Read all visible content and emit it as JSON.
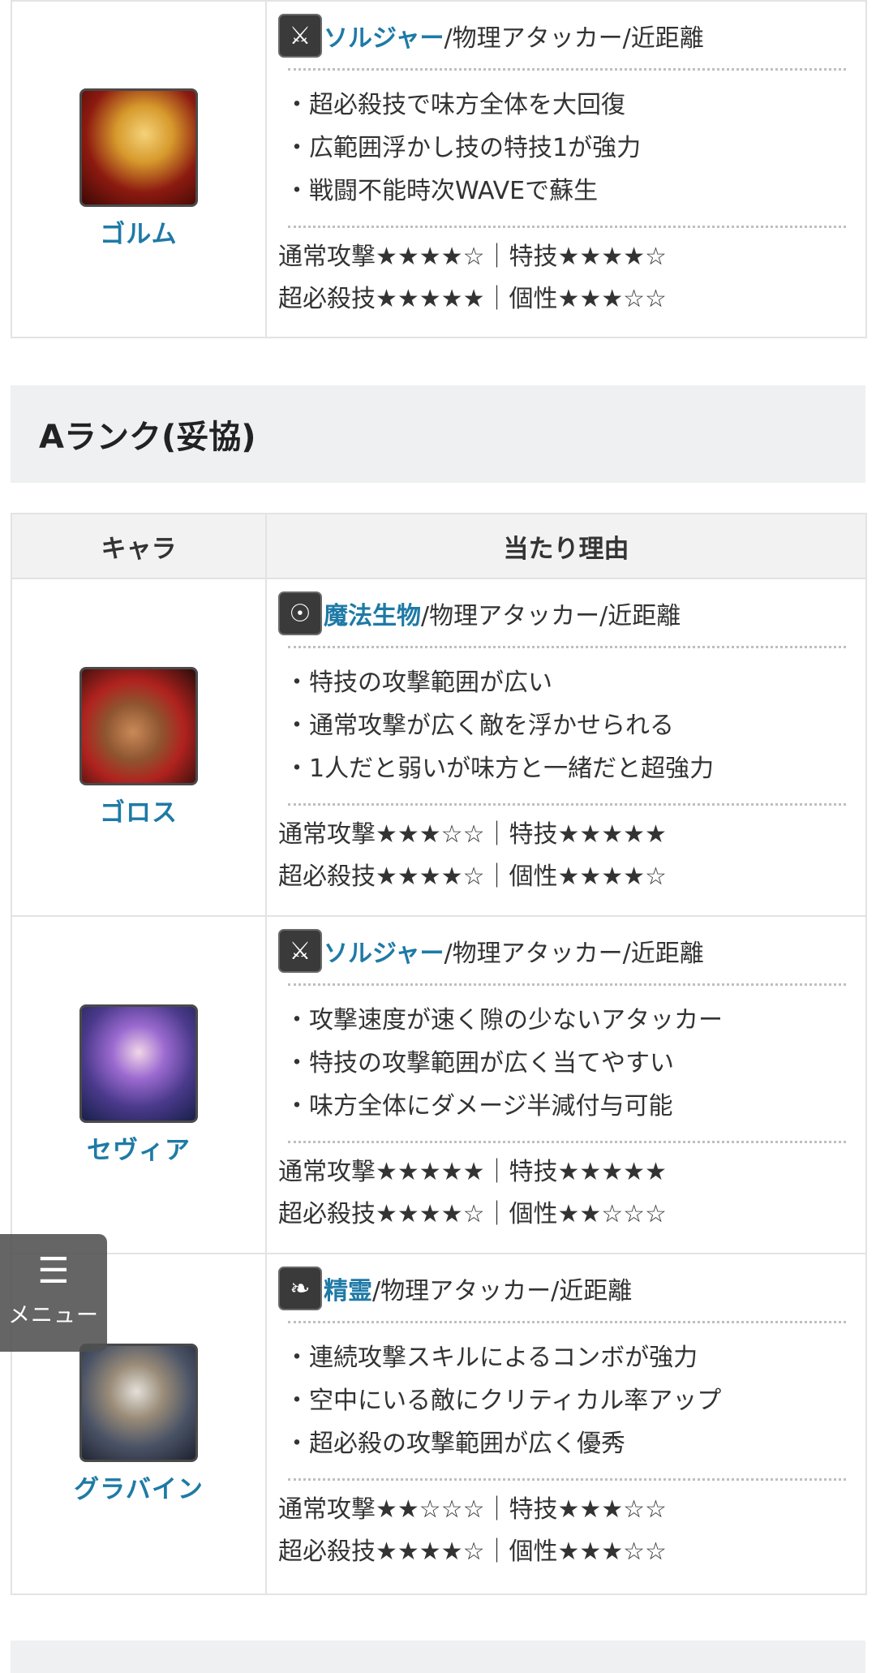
{
  "top_row": {
    "name": "ゴルム",
    "class_icon": "soldier-icon",
    "class_name": "ソルジャー",
    "class_rest": "/物理アタッカー/近距離",
    "points": [
      "超必殺技で味方全体を大回復",
      "広範囲浮かし技の特技1が強力",
      "戦闘不能時次WAVEで蘇生"
    ],
    "rating1": "通常攻撃★★★★☆｜特技★★★★☆",
    "rating2": "超必殺技★★★★★｜個性★★★☆☆"
  },
  "section_a": {
    "title": "Aランク(妥協)",
    "col_char": "キャラ",
    "col_reason": "当たり理由",
    "rows": [
      {
        "name": "ゴロス",
        "class_icon": "magic-creature-icon",
        "class_name": "魔法生物",
        "class_rest": "/物理アタッカー/近距離",
        "points": [
          "特技の攻撃範囲が広い",
          "通常攻撃が広く敵を浮かせられる",
          "1人だと弱いが味方と一緒だと超強力"
        ],
        "rating1": "通常攻撃★★★☆☆｜特技★★★★★",
        "rating2": "超必殺技★★★★☆｜個性★★★★☆"
      },
      {
        "name": "セヴィア",
        "class_icon": "soldier-icon",
        "class_name": "ソルジャー",
        "class_rest": "/物理アタッカー/近距離",
        "points": [
          "攻撃速度が速く隙の少ないアタッカー",
          "特技の攻撃範囲が広く当てやすい",
          "味方全体にダメージ半減付与可能"
        ],
        "rating1": "通常攻撃★★★★★｜特技★★★★★",
        "rating2": "超必殺技★★★★☆｜個性★★☆☆☆"
      },
      {
        "name": "グラバイン",
        "class_icon": "spirit-icon",
        "class_name": "精霊",
        "class_rest": "/物理アタッカー/近距離",
        "points": [
          "連続攻撃スキルによるコンボが強力",
          "空中にいる敵にクリティカル率アップ",
          "超必殺の攻撃範囲が広く優秀"
        ],
        "rating1": "通常攻撃★★☆☆☆｜特技★★★☆☆",
        "rating2": "超必殺技★★★★☆｜個性★★★☆☆"
      }
    ]
  },
  "menu": {
    "label": "メニュー",
    "icon": "list-icon"
  }
}
